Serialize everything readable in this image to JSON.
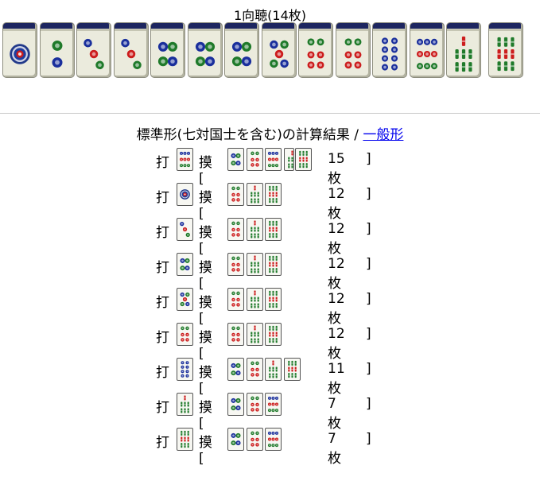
{
  "hand": {
    "title": "1向聴(14枚)",
    "tiles": [
      "1p",
      "2p",
      "3p",
      "3p",
      "4p",
      "4p",
      "4p",
      "5p",
      "6p",
      "6p",
      "8p",
      "9p",
      "7s",
      "9s"
    ]
  },
  "results": {
    "title_main": "標準形(七対国士を含む)の計算結果",
    "separator": " / ",
    "other_link": "一般形",
    "discard_label": "打",
    "draw_open": "摸[",
    "close_bracket": "]",
    "rows": [
      {
        "discard": "9p",
        "draws": [
          "4p",
          "6p",
          "9p",
          "7s",
          "9s"
        ],
        "count": "15枚"
      },
      {
        "discard": "1p",
        "draws": [
          "6p",
          "7s",
          "9s"
        ],
        "count": "12枚"
      },
      {
        "discard": "3p",
        "draws": [
          "6p",
          "7s",
          "9s"
        ],
        "count": "12枚"
      },
      {
        "discard": "4p",
        "draws": [
          "6p",
          "7s",
          "9s"
        ],
        "count": "12枚"
      },
      {
        "discard": "5p",
        "draws": [
          "6p",
          "7s",
          "9s"
        ],
        "count": "12枚"
      },
      {
        "discard": "6p",
        "draws": [
          "6p",
          "7s",
          "9s"
        ],
        "count": "12枚"
      },
      {
        "discard": "8p",
        "draws": [
          "4p",
          "6p",
          "7s",
          "9s"
        ],
        "count": "11枚"
      },
      {
        "discard": "7s",
        "draws": [
          "4p",
          "6p",
          "9p"
        ],
        "count": "7枚"
      },
      {
        "discard": "9s",
        "draws": [
          "4p",
          "6p",
          "9p"
        ],
        "count": "7枚"
      }
    ]
  },
  "colors": {
    "pin_blue": "#1a2f9c",
    "pin_red": "#cc1d1d",
    "sou_green": "#1f7a2a",
    "tile_back": "#1d2660",
    "link": "#0000ee"
  }
}
